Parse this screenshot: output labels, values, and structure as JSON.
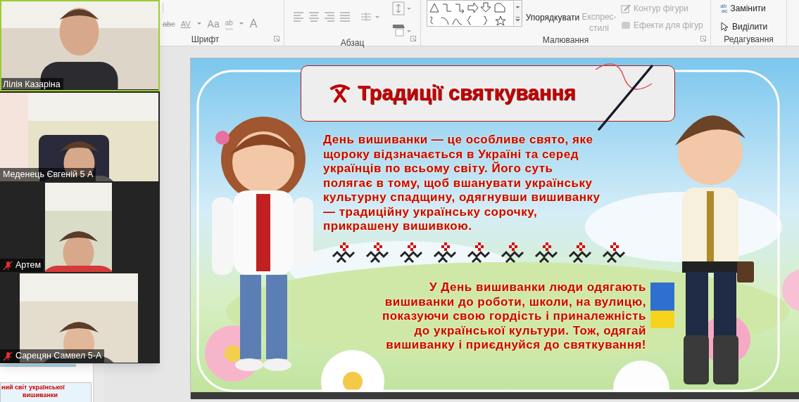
{
  "ribbon": {
    "groups": [
      {
        "label": "Шрифт"
      },
      {
        "label": "Абзац"
      },
      {
        "label": "Малювання"
      },
      {
        "label": "Редагування"
      }
    ],
    "drawing_buttons": [
      {
        "label": "Упорядкувати",
        "disabled": false
      },
      {
        "label": "Експрес-стилі",
        "disabled": true
      }
    ],
    "shape_format": [
      {
        "label": "Контур фігури",
        "disabled": true
      },
      {
        "label": "Ефекти для фігур",
        "disabled": true
      }
    ],
    "font_tools": [
      {
        "label": "abc"
      },
      {
        "label": "AV"
      },
      {
        "label": "Aa"
      },
      {
        "label": "ab"
      },
      {
        "label": "A"
      }
    ],
    "replace_icon_text": [
      "ab",
      "ac"
    ],
    "editing": [
      {
        "label": "Замінити"
      },
      {
        "label": "Виділити"
      }
    ]
  },
  "video_panel": {
    "participants": [
      {
        "name": "Лілія Казаріна",
        "muted": false,
        "active": true
      },
      {
        "name": "Меденець Євгеній 5 А",
        "muted": false,
        "active": false
      },
      {
        "name": "Артем",
        "muted": true,
        "active": false
      },
      {
        "name": "Сарецян Самвел 5-А",
        "muted": true,
        "active": false
      }
    ]
  },
  "thumbnail": {
    "lines": [
      "ний світ української",
      "вишиванки"
    ]
  },
  "slide": {
    "title": "Традиції святкування",
    "paragraphs": [
      "День вишиванки — це особливе свято, яке щороку відзначається в Україні та серед українців по всьому світу. Його суть полягає в тому, щоб вшанувати українську культурну спадщину, одягнувши вишиванку — традиційну українську сорочку, прикрашену вишивкою.",
      "У День вишиванки люди одягають вишиванки до роботи, школи, на вулицю, показуючи свою гордість і приналежність до української культури. Тож, одягай вишиванку і приєднуйся до святкування!"
    ]
  }
}
